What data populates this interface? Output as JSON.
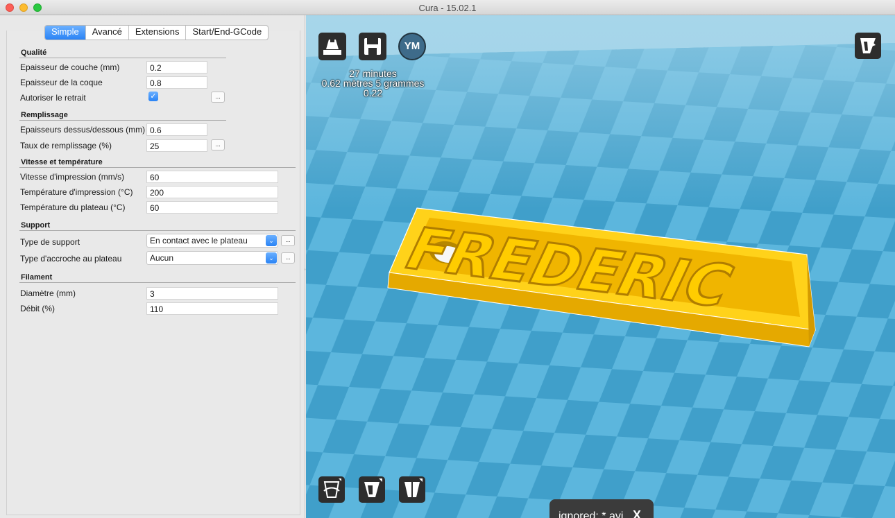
{
  "window": {
    "title": "Cura - 15.02.1"
  },
  "tabs": [
    "Simple",
    "Avancé",
    "Extensions",
    "Start/End-GCode"
  ],
  "sections": {
    "quality": "Qualité",
    "infill": "Remplissage",
    "speed": "Vitesse et température",
    "support": "Support",
    "filament": "Filament"
  },
  "settings": {
    "layer_height": {
      "label": "Epaisseur de couche (mm)",
      "value": "0.2"
    },
    "shell_thickness": {
      "label": "Epaisseur de la coque",
      "value": "0.8"
    },
    "retraction": {
      "label": "Autoriser le retrait",
      "checked": true
    },
    "top_bottom": {
      "label": "Epaisseurs dessus/dessous (mm)",
      "value": "0.6"
    },
    "fill_density": {
      "label": "Taux de remplissage (%)",
      "value": "25"
    },
    "print_speed": {
      "label": "Vitesse d'impression (mm/s)",
      "value": "60"
    },
    "print_temp": {
      "label": "Température d'impression (°C)",
      "value": "200"
    },
    "bed_temp": {
      "label": "Température du plateau (°C)",
      "value": "60"
    },
    "support_type": {
      "label": "Type de support",
      "value": "En contact avec le plateau"
    },
    "platform_adhesion": {
      "label": "Type d'accroche au plateau",
      "value": "Aucun"
    },
    "diameter": {
      "label": "Diamètre (mm)",
      "value": "3"
    },
    "flow": {
      "label": "Débit (%)",
      "value": "110"
    }
  },
  "ellipsis": "...",
  "checkmark": "✓",
  "viewport": {
    "avatar_initials": "YM",
    "print_info": {
      "time": "27 minutes",
      "material": "0.62 mètres 5 grammes",
      "cost": "0.22"
    },
    "model_text": "FREDERIC",
    "toast": {
      "text": "ignored: *.avi",
      "close": "X"
    },
    "colors": {
      "sky": "#9ccfe6",
      "plate_light": "#5fb8de",
      "plate_dark": "#3b9fca",
      "model": "#f4c100"
    },
    "icons": [
      "load-model-icon",
      "save-gcode-icon",
      "view-mode-icon",
      "rotate-tool-icon",
      "scale-tool-icon",
      "mirror-tool-icon"
    ]
  }
}
